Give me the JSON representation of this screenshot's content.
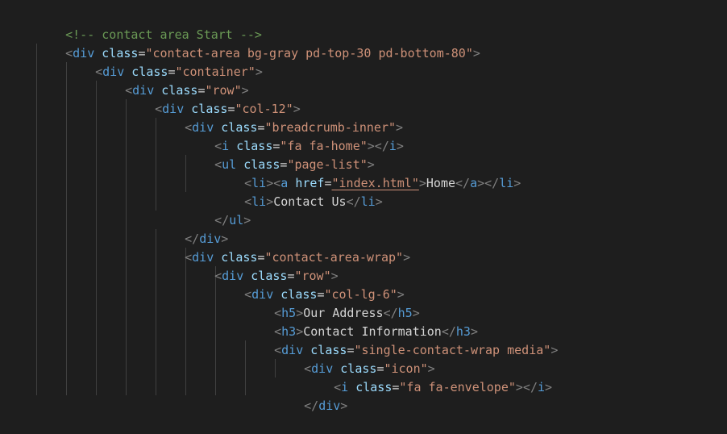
{
  "editor": {
    "background": "#1e1e1e",
    "colors": {
      "comment": "#6a9955",
      "tag": "#569cd6",
      "bracket": "#808080",
      "attribute": "#9cdcfe",
      "string": "#ce9178",
      "text": "#d4d4d4",
      "indent_guide": "#404040"
    }
  },
  "lines": [
    {
      "comment": "<!-- contact area Start -->"
    },
    {
      "open": "<",
      "tag": "div",
      "attr": "class",
      "value": "\"contact-area bg-gray pd-top-30 pd-bottom-80\"",
      "close": ">"
    },
    {
      "open": "<",
      "tag": "div",
      "attr": "class",
      "value": "\"container\"",
      "close": ">"
    },
    {
      "open": "<",
      "tag": "div",
      "attr": "class",
      "value": "\"row\"",
      "close": ">"
    },
    {
      "open": "<",
      "tag": "div",
      "attr": "class",
      "value": "\"col-12\"",
      "close": ">"
    },
    {
      "open": "<",
      "tag": "div",
      "attr": "class",
      "value": "\"breadcrumb-inner\"",
      "close": ">"
    },
    {
      "open": "<",
      "tag": "i",
      "attr": "class",
      "value": "\"fa fa-home\"",
      "close": "></",
      "end_tag": "i",
      "end_close": ">"
    },
    {
      "open": "<",
      "tag": "ul",
      "attr": "class",
      "value": "\"page-list\"",
      "close": ">"
    },
    {
      "open": "<",
      "tag": "li",
      "close": "><",
      "tag2": "a",
      "attr": "href",
      "value": "\"index.html\"",
      "close2": ">",
      "text": "Home",
      "end1_open": "</",
      "end1_tag": "a",
      "end1_close": "></",
      "end2_tag": "li",
      "end2_close": ">"
    },
    {
      "open": "<",
      "tag": "li",
      "close": ">",
      "text": "Contact Us",
      "end_open": "</",
      "end_tag": "li",
      "end_close": ">"
    },
    {
      "open": "</",
      "tag": "ul",
      "close": ">"
    },
    {
      "open": "</",
      "tag": "div",
      "close": ">"
    },
    {
      "open": "<",
      "tag": "div",
      "attr": "class",
      "value": "\"contact-area-wrap\"",
      "close": ">"
    },
    {
      "open": "<",
      "tag": "div",
      "attr": "class",
      "value": "\"row\"",
      "close": ">"
    },
    {
      "open": "<",
      "tag": "div",
      "attr": "class",
      "value": "\"col-lg-6\"",
      "close": ">"
    },
    {
      "open": "<",
      "tag": "h5",
      "close": ">",
      "text": "Our Address",
      "end_open": "</",
      "end_tag": "h5",
      "end_close": ">"
    },
    {
      "open": "<",
      "tag": "h3",
      "close": ">",
      "text": "Contact Information",
      "end_open": "</",
      "end_tag": "h3",
      "end_close": ">"
    },
    {
      "open": "<",
      "tag": "div",
      "attr": "class",
      "value": "\"single-contact-wrap media\"",
      "close": ">"
    },
    {
      "open": "<",
      "tag": "div",
      "attr": "class",
      "value": "\"icon\"",
      "close": ">"
    },
    {
      "open": "<",
      "tag": "i",
      "attr": "class",
      "value": "\"fa fa-envelope\"",
      "close": "></",
      "end_tag": "i",
      "end_close": ">"
    },
    {
      "open": "</",
      "tag": "div",
      "close": ">"
    }
  ]
}
